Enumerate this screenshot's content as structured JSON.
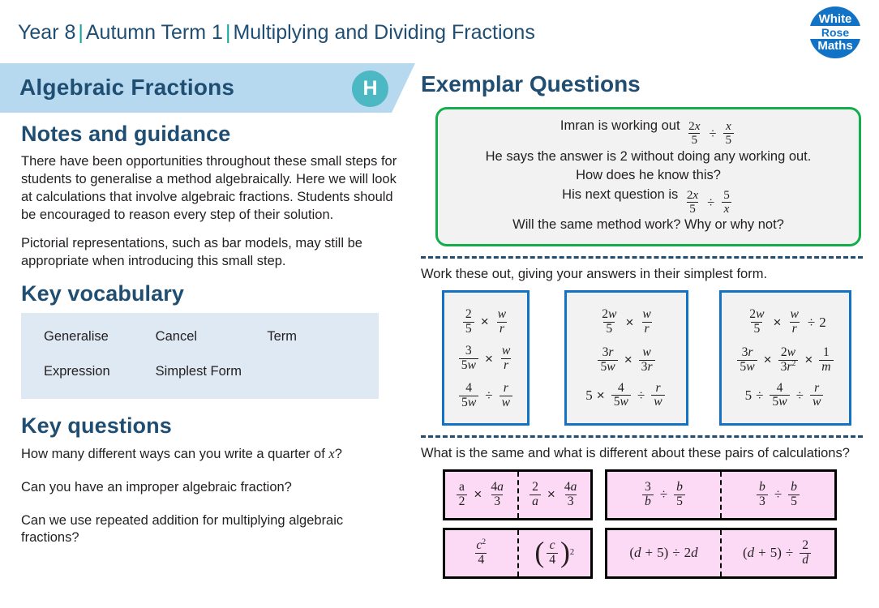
{
  "header": {
    "year": "Year 8",
    "term": "Autumn Term 1",
    "topic": "Multiplying and Dividing Fractions",
    "separator": "|"
  },
  "logo": {
    "line1": "White",
    "line2": "Rose",
    "line3": "Maths",
    "brand_color": "#1273c6"
  },
  "banner": {
    "title": "Algebraic Fractions",
    "badge": "H",
    "badge_color": "#4cb8c4",
    "background": "#b7d9ef"
  },
  "notes": {
    "heading": "Notes and guidance",
    "paragraphs": [
      "There have been opportunities throughout these small steps for students to generalise a method algebraically. Here we will look at calculations that involve algebraic fractions. Students should be encouraged to reason every step of their solution.",
      "Pictorial representations, such as bar models, may still be appropriate when introducing this small step."
    ]
  },
  "vocabulary": {
    "heading": "Key vocabulary",
    "background": "#dfe9f3",
    "rows": [
      [
        "Generalise",
        "Cancel",
        "Term"
      ],
      [
        "Expression",
        "Simplest Form",
        ""
      ]
    ]
  },
  "key_questions": {
    "heading": "Key questions",
    "items": [
      "How many different ways can you write a quarter of x?",
      "Can you have an improper algebraic fraction?",
      "Can we use repeated addition for multiplying algebraic fractions?"
    ],
    "q1_prefix": "How many different ways can you write a quarter of ",
    "q1_var": "x",
    "q1_suffix": "?",
    "q2": "Can you have an improper algebraic fraction?",
    "q3": "Can we use repeated addition for multiplying algebraic fractions?"
  },
  "exemplar": {
    "heading": "Exemplar Questions",
    "green_box": {
      "border_color": "#13ae4b",
      "background": "#f2f2f2",
      "line1_prefix": "Imran is working out ",
      "line1_math": "2x/5 ÷ x/5",
      "line2": "He says the answer is 2 without doing any working out.",
      "line3": "How does he know this?",
      "line4_prefix": "His next question is ",
      "line4_math": "2x/5 ÷ 5/x",
      "line5": "Will the same method work? Why or why not?"
    },
    "instruction_1": "Work these out, giving your answers in their simplest form.",
    "blue_boxes": {
      "border_color": "#1273c6",
      "background": "#f2f2f2",
      "columns": [
        {
          "calcs": [
            "2/5 × w/r",
            "3/5w × w/r",
            "4/5w ÷ r/w"
          ]
        },
        {
          "calcs": [
            "2w/5 × w/r",
            "3r/5w × w/3r",
            "5 × 4/5w ÷ r/w"
          ]
        },
        {
          "calcs": [
            "2w/5 × w/r ÷ 2",
            "3r/5w × 2w/3r² × 1/m",
            "5 ÷ 4/5w ÷ r/w"
          ]
        }
      ]
    },
    "instruction_2": "What is the same and what is different about these pairs of calculations?",
    "pink_boxes": {
      "border_color": "#000000",
      "background": "#fcd9f4",
      "pairs": [
        {
          "left": "a/2 × 4a/3",
          "right": "2/a × 4a/3"
        },
        {
          "left": "3/b ÷ b/5",
          "right": "b/3 ÷ b/5"
        },
        {
          "left": "c²/4",
          "right": "(c/4)²"
        },
        {
          "left": "(d + 5) ÷ 2d",
          "right": "(d + 5) ÷ 2/d"
        }
      ]
    }
  }
}
